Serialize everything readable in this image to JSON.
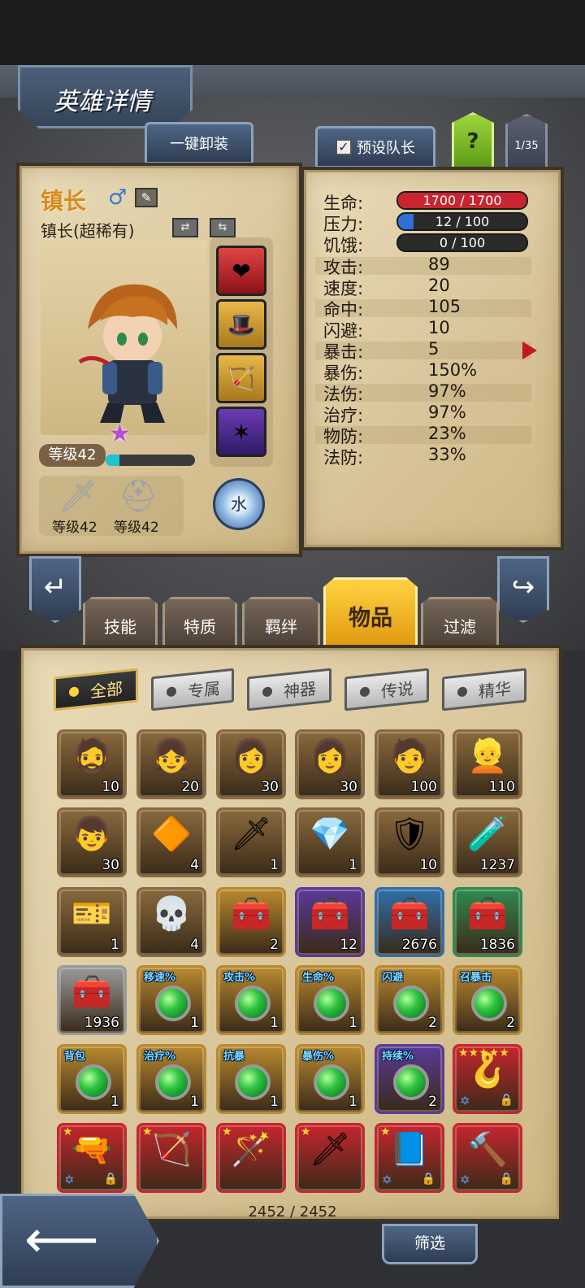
{
  "header": {
    "title": "英雄详情",
    "unequip_all": "一键卸装",
    "preset_captain": "预设队长",
    "help": "?",
    "page": "1/35"
  },
  "hero": {
    "name": "镇长",
    "subtitle": "镇长(超稀有)",
    "level": "等级42",
    "exp_fraction": 0.15,
    "weapon_level": "等级42",
    "armor_level": "等级42",
    "element": "水",
    "stars": 1
  },
  "stats": {
    "hp": {
      "label": "生命:",
      "value": "1700 / 1700",
      "fill": 1.0,
      "color": "#c9242f"
    },
    "stress": {
      "label": "压力:",
      "value": "12 / 100",
      "fill": 0.12,
      "color": "#2f6fd6"
    },
    "hunger": {
      "label": "饥饿:",
      "value": "0 / 100",
      "fill": 0.0,
      "color": "#2f6fd6"
    },
    "rows": [
      {
        "label": "攻击:",
        "value": "89"
      },
      {
        "label": "速度:",
        "value": "20"
      },
      {
        "label": "命中:",
        "value": "105"
      },
      {
        "label": "闪避:",
        "value": "10"
      },
      {
        "label": "暴击:",
        "value": "5"
      },
      {
        "label": "暴伤:",
        "value": "150%"
      },
      {
        "label": "法伤:",
        "value": "97%"
      },
      {
        "label": "治疗:",
        "value": "97%"
      },
      {
        "label": "物防:",
        "value": "23%"
      },
      {
        "label": "法防:",
        "value": "33%"
      }
    ]
  },
  "tabs": [
    "技能",
    "特质",
    "羁绊",
    "物品",
    "过滤"
  ],
  "filters": [
    "全部",
    "专属",
    "神器",
    "传说",
    "精华"
  ],
  "items": [
    {
      "count": "10",
      "bg": "#8a6a3d",
      "art": "🧔"
    },
    {
      "count": "20",
      "bg": "#8a6a3d",
      "art": "👧"
    },
    {
      "count": "30",
      "bg": "#8a6a3d",
      "art": "👩"
    },
    {
      "count": "30",
      "bg": "#8a6a3d",
      "art": "👩"
    },
    {
      "count": "100",
      "bg": "#8a6a3d",
      "art": "🧑"
    },
    {
      "count": "110",
      "bg": "#8a6a3d",
      "art": "👱"
    },
    {
      "count": "30",
      "bg": "#8a6a3d",
      "art": "👦"
    },
    {
      "count": "4",
      "bg": "#8a6a3d",
      "art": "🔶"
    },
    {
      "count": "1",
      "bg": "#8a6a3d",
      "art": "🗡"
    },
    {
      "count": "1",
      "bg": "#8a6a3d",
      "art": "💎"
    },
    {
      "count": "10",
      "bg": "#8a6a3d",
      "art": "🛡"
    },
    {
      "count": "1237",
      "bg": "#8a6a3d",
      "art": "🧪"
    },
    {
      "count": "1",
      "bg": "#8a6a3d",
      "art": "🎫"
    },
    {
      "count": "4",
      "bg": "#8a6a3d",
      "art": "💀"
    },
    {
      "count": "2",
      "bg": "#b9892f",
      "art": "🧰"
    },
    {
      "count": "12",
      "bg": "#5b3a96",
      "art": "🧰"
    },
    {
      "count": "2676",
      "bg": "#2f6fa8",
      "art": "🧰"
    },
    {
      "count": "1836",
      "bg": "#2f8a4f",
      "art": "🧰"
    },
    {
      "count": "1936",
      "bg": "#9a9a9a",
      "art": "🧰"
    },
    {
      "count": "1",
      "bg": "#b9892f",
      "tag": "移速%",
      "gem": true
    },
    {
      "count": "1",
      "bg": "#b9892f",
      "tag": "攻击%",
      "gem": true
    },
    {
      "count": "1",
      "bg": "#b9892f",
      "tag": "生命%",
      "gem": true
    },
    {
      "count": "2",
      "bg": "#b9892f",
      "tag": "闪避",
      "gem": true
    },
    {
      "count": "2",
      "bg": "#b9892f",
      "tag": "召暴击",
      "gem": true
    },
    {
      "count": "1",
      "bg": "#b9892f",
      "tag": "背包",
      "gem": true
    },
    {
      "count": "1",
      "bg": "#b9892f",
      "tag": "治疗%",
      "gem": true
    },
    {
      "count": "1",
      "bg": "#b9892f",
      "tag": "抗暴",
      "gem": true
    },
    {
      "count": "1",
      "bg": "#b9892f",
      "tag": "暴伤%",
      "gem": true
    },
    {
      "count": "2",
      "bg": "#5b3a96",
      "tag": "持续%",
      "gem": true
    },
    {
      "count": "",
      "bg": "#c6262d",
      "art": "🪝",
      "stars": "★★★★★",
      "lock": true
    },
    {
      "count": "",
      "bg": "#c6262d",
      "art": "🔫",
      "stars": "★",
      "lock": true
    },
    {
      "count": "",
      "bg": "#c6262d",
      "art": "🏹",
      "stars": "★",
      "lock": false
    },
    {
      "count": "",
      "bg": "#c6262d",
      "art": "🪄",
      "stars": "★",
      "lock": false
    },
    {
      "count": "",
      "bg": "#c6262d",
      "art": "🗡",
      "stars": "★",
      "lock": false
    },
    {
      "count": "",
      "bg": "#c6262d",
      "art": "📘",
      "stars": "★",
      "lock": true
    },
    {
      "count": "",
      "bg": "#c6262d",
      "art": "🔨",
      "stars": "",
      "lock": true
    }
  ],
  "footer": {
    "inventory_count": "2452 / 2452",
    "filter_button": "筛选"
  }
}
